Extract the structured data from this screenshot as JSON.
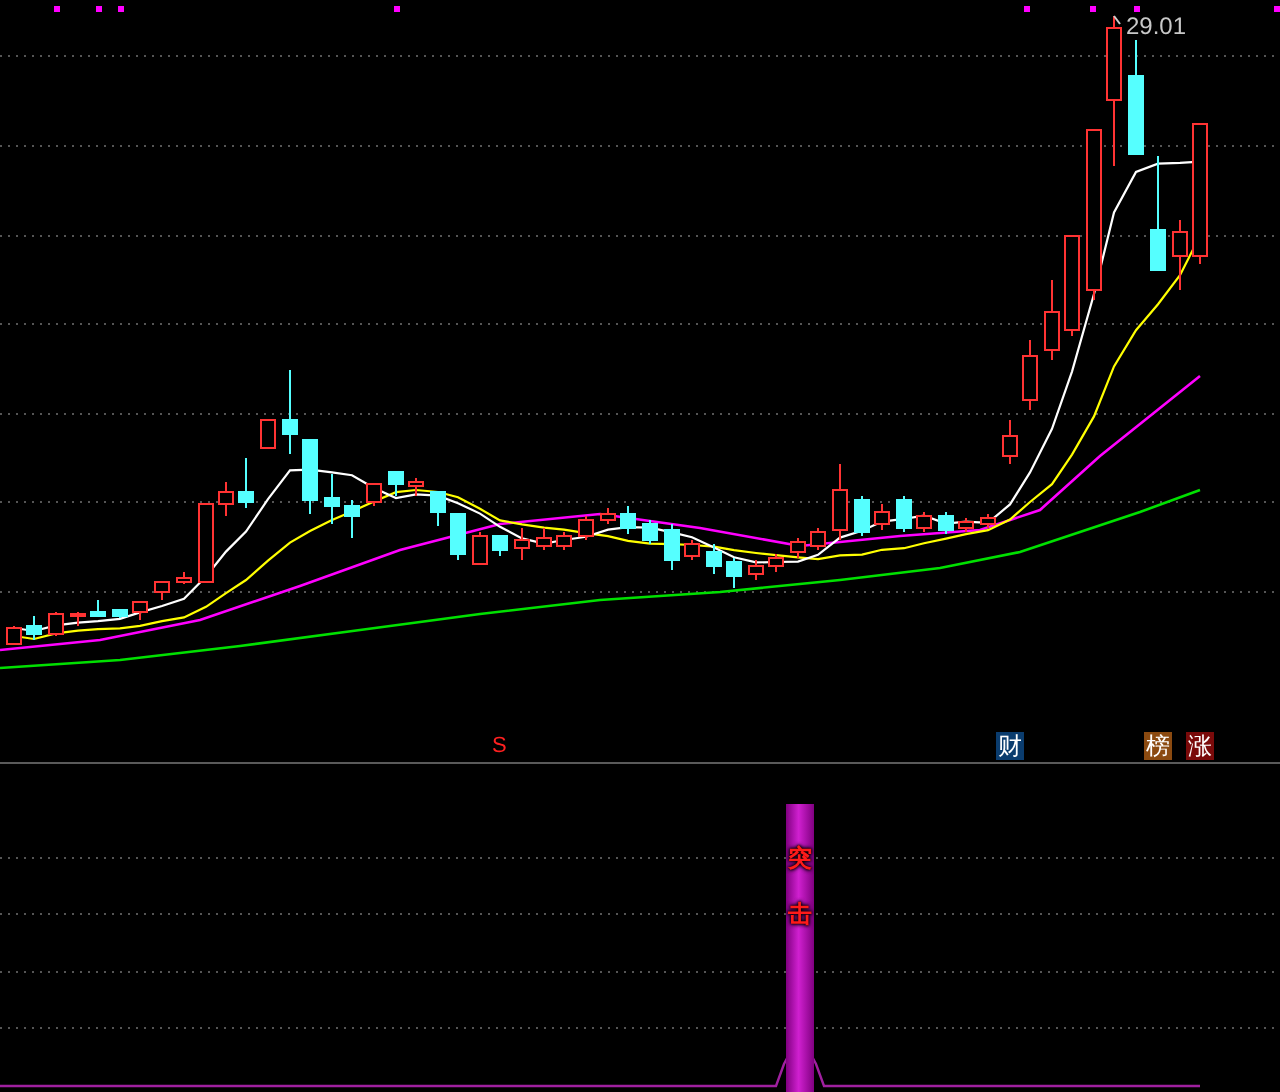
{
  "price_chart": {
    "high_label": "29.01",
    "signals": [
      {
        "text": "S"
      }
    ],
    "badges": [
      {
        "text": "财",
        "color": "#0a3c6e"
      },
      {
        "text": "榜",
        "color": "#8b4a10"
      },
      {
        "text": "涨",
        "color": "#7a0a0a"
      }
    ]
  },
  "indicator_panel": {
    "bar_label": "突击"
  }
}
